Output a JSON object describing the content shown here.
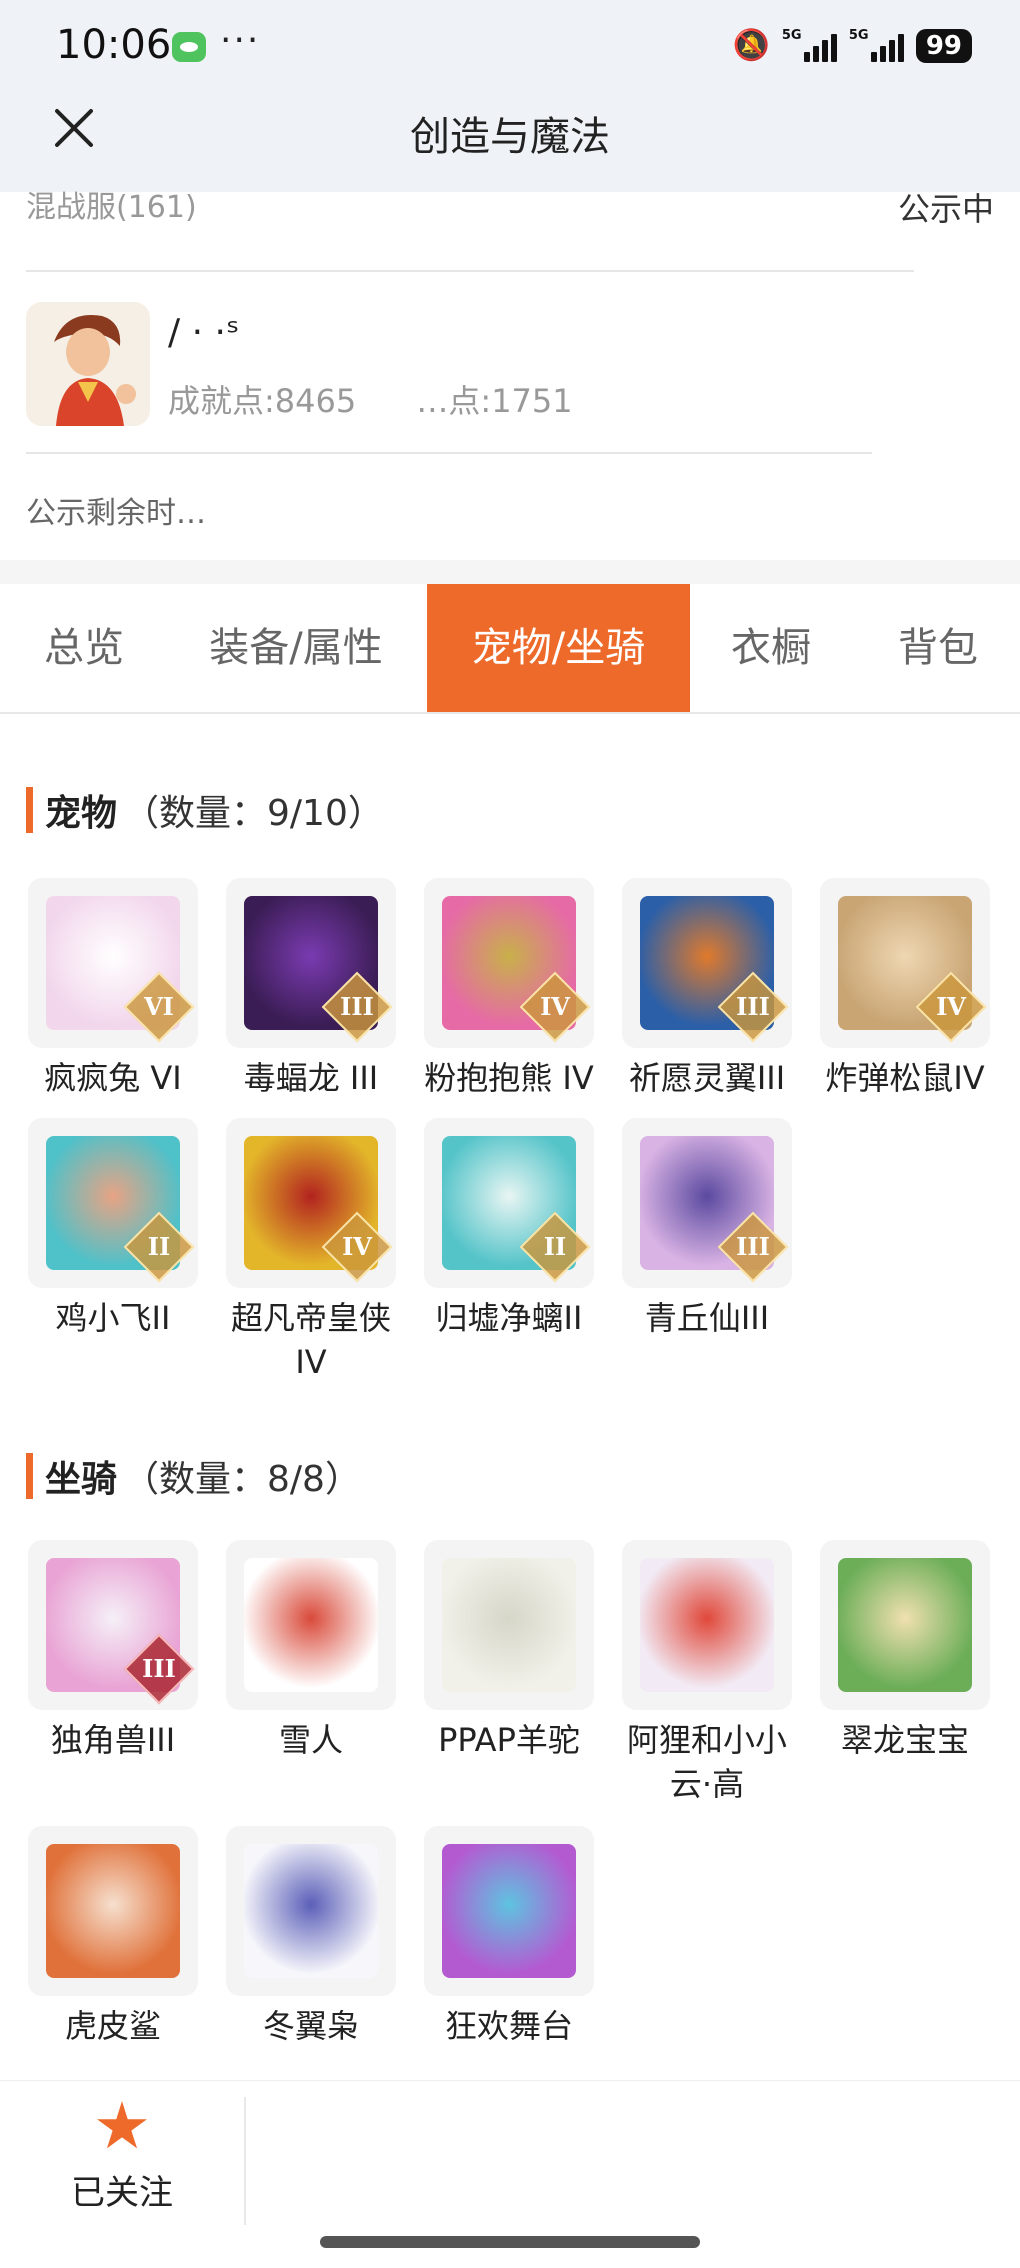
{
  "status_bar": {
    "time": "10:06",
    "dots": "···",
    "signal1_tag": "5G",
    "signal2_tag": "5G",
    "battery": "99"
  },
  "header": {
    "title": "创造与魔法"
  },
  "info": {
    "server": "混战服(161)",
    "status": "公示中",
    "nickname": "/  ·  ·ˢ",
    "achievement": "成就点:8465",
    "other_points": "…点:1751",
    "remain_time": "公示剩余时…"
  },
  "tabs": [
    "总览",
    "装备/属性",
    "宠物/坐骑",
    "衣橱",
    "背包"
  ],
  "active_tab": "宠物/坐骑",
  "pets": {
    "title": "宠物",
    "count": "（数量：9/10）",
    "items": [
      {
        "name": "疯疯兔 VI",
        "badge": "VI",
        "icon": "rabbit-icon",
        "colors": [
          "#f2d7ec",
          "#fff"
        ]
      },
      {
        "name": "毒蝠龙 III",
        "badge": "III",
        "icon": "dragon-icon",
        "colors": [
          "#3b1d55",
          "#7a3bb1"
        ]
      },
      {
        "name": "粉抱抱熊 IV",
        "badge": "IV",
        "icon": "bear-icon",
        "colors": [
          "#e66aa6",
          "#c8b04a"
        ]
      },
      {
        "name": "祈愿灵翼III",
        "badge": "III",
        "icon": "eagle-icon",
        "colors": [
          "#2b5fa8",
          "#e07a2c"
        ]
      },
      {
        "name": "炸弹松鼠IV",
        "badge": "IV",
        "icon": "squirrel-icon",
        "colors": [
          "#c9a574",
          "#eed7b2"
        ]
      },
      {
        "name": "鸡小飞II",
        "badge": "II",
        "icon": "muscle-chick-icon",
        "colors": [
          "#4fc1c9",
          "#e8a384"
        ]
      },
      {
        "name": "超凡帝皇侠IV",
        "badge": "IV",
        "icon": "armor-hero-icon",
        "colors": [
          "#e3b62a",
          "#b2231f"
        ]
      },
      {
        "name": "归墟净螭II",
        "badge": "II",
        "icon": "sea-dragon-icon",
        "colors": [
          "#55c4c9",
          "#e8f5f3"
        ]
      },
      {
        "name": "青丘仙III",
        "badge": "III",
        "icon": "fox-fairy-icon",
        "colors": [
          "#d9b3e4",
          "#5b4aa0"
        ]
      }
    ]
  },
  "mounts": {
    "title": "坐骑",
    "count": "（数量：8/8）",
    "items": [
      {
        "name": "独角兽III",
        "badge": "III",
        "icon": "unicorn-icon",
        "colors": [
          "#e9a4d5",
          "#f5f0f7"
        ]
      },
      {
        "name": "雪人",
        "badge": "",
        "icon": "snowman-icon",
        "colors": [
          "#ffffff",
          "#d94a3a"
        ]
      },
      {
        "name": "PPAP羊驼",
        "badge": "",
        "icon": "alpaca-icon",
        "colors": [
          "#f1f1e9",
          "#d6d6c9"
        ]
      },
      {
        "name": "阿狸和小小云·高",
        "badge": "",
        "icon": "ali-cloud-icon",
        "colors": [
          "#f2eaf4",
          "#e0483a"
        ]
      },
      {
        "name": "翠龙宝宝",
        "badge": "",
        "icon": "baby-dragon-icon",
        "colors": [
          "#6cae58",
          "#f0e0b0"
        ]
      },
      {
        "name": "虎皮鲨",
        "badge": "",
        "icon": "shark-icon",
        "colors": [
          "#e0713a",
          "#f6e0cf"
        ]
      },
      {
        "name": "冬翼枭",
        "badge": "",
        "icon": "owl-icon",
        "colors": [
          "#f6f6fb",
          "#5b5fb8"
        ]
      },
      {
        "name": "狂欢舞台",
        "badge": "",
        "icon": "stage-icon",
        "colors": [
          "#b45ad1",
          "#5ec3e0"
        ]
      }
    ]
  },
  "bottom": {
    "follow": "已关注"
  },
  "accent": "#ee6a2a"
}
